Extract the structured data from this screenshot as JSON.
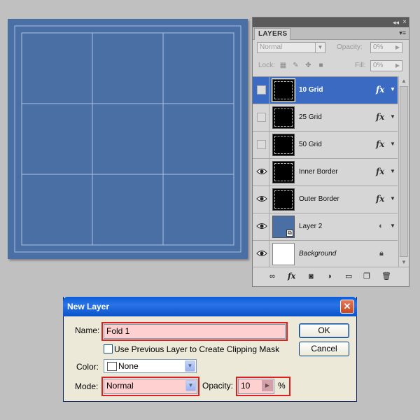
{
  "canvas": {
    "background_color": "#4a6fa5",
    "grid_line_color": "#a8c0e0"
  },
  "layers_panel": {
    "tab_label": "LAYERS",
    "collapse_glyph": "◂◂",
    "close_glyph": "×",
    "menu_glyph": "▾≡",
    "blend_mode": "Normal",
    "opacity_label": "Opacity:",
    "opacity_value": "0%",
    "lock_label": "Lock:",
    "fill_label": "Fill:",
    "fill_value": "0%",
    "layers": [
      {
        "name": "10 Grid",
        "visible": false,
        "selected": true,
        "fx": true,
        "thumb": "black-dashed"
      },
      {
        "name": "25 Grid",
        "visible": false,
        "selected": false,
        "fx": true,
        "thumb": "black-dashed"
      },
      {
        "name": "50 Grid",
        "visible": false,
        "selected": false,
        "fx": true,
        "thumb": "black-dashed"
      },
      {
        "name": "Inner Border",
        "visible": true,
        "selected": false,
        "fx": true,
        "thumb": "black-dashed"
      },
      {
        "name": "Outer Border",
        "visible": true,
        "selected": false,
        "fx": true,
        "thumb": "black-dashed"
      },
      {
        "name": "Layer 2",
        "visible": true,
        "selected": false,
        "fx": false,
        "thumb": "blue-smart"
      },
      {
        "name": "Background",
        "visible": true,
        "selected": false,
        "fx": false,
        "thumb": "white",
        "locked": true
      }
    ],
    "fx_label": "fx",
    "bottom_icons": [
      "link-icon",
      "fx-icon",
      "mask-icon",
      "adjustment-icon",
      "group-icon",
      "new-layer-icon",
      "trash-icon"
    ]
  },
  "dialog": {
    "title": "New Layer",
    "close_glyph": "✕",
    "name_label": "Name:",
    "name_value": "Fold 1",
    "ok_label": "OK",
    "cancel_label": "Cancel",
    "clipping_mask_label": "Use Previous Layer to Create Clipping Mask",
    "clipping_mask_checked": false,
    "color_label": "Color:",
    "color_value": "None",
    "mode_label": "Mode:",
    "mode_value": "Normal",
    "opacity_label": "Opacity:",
    "opacity_value": "10",
    "opacity_unit": "%",
    "highlight_color": "#e02020",
    "title_color": "#0b5cd6"
  }
}
